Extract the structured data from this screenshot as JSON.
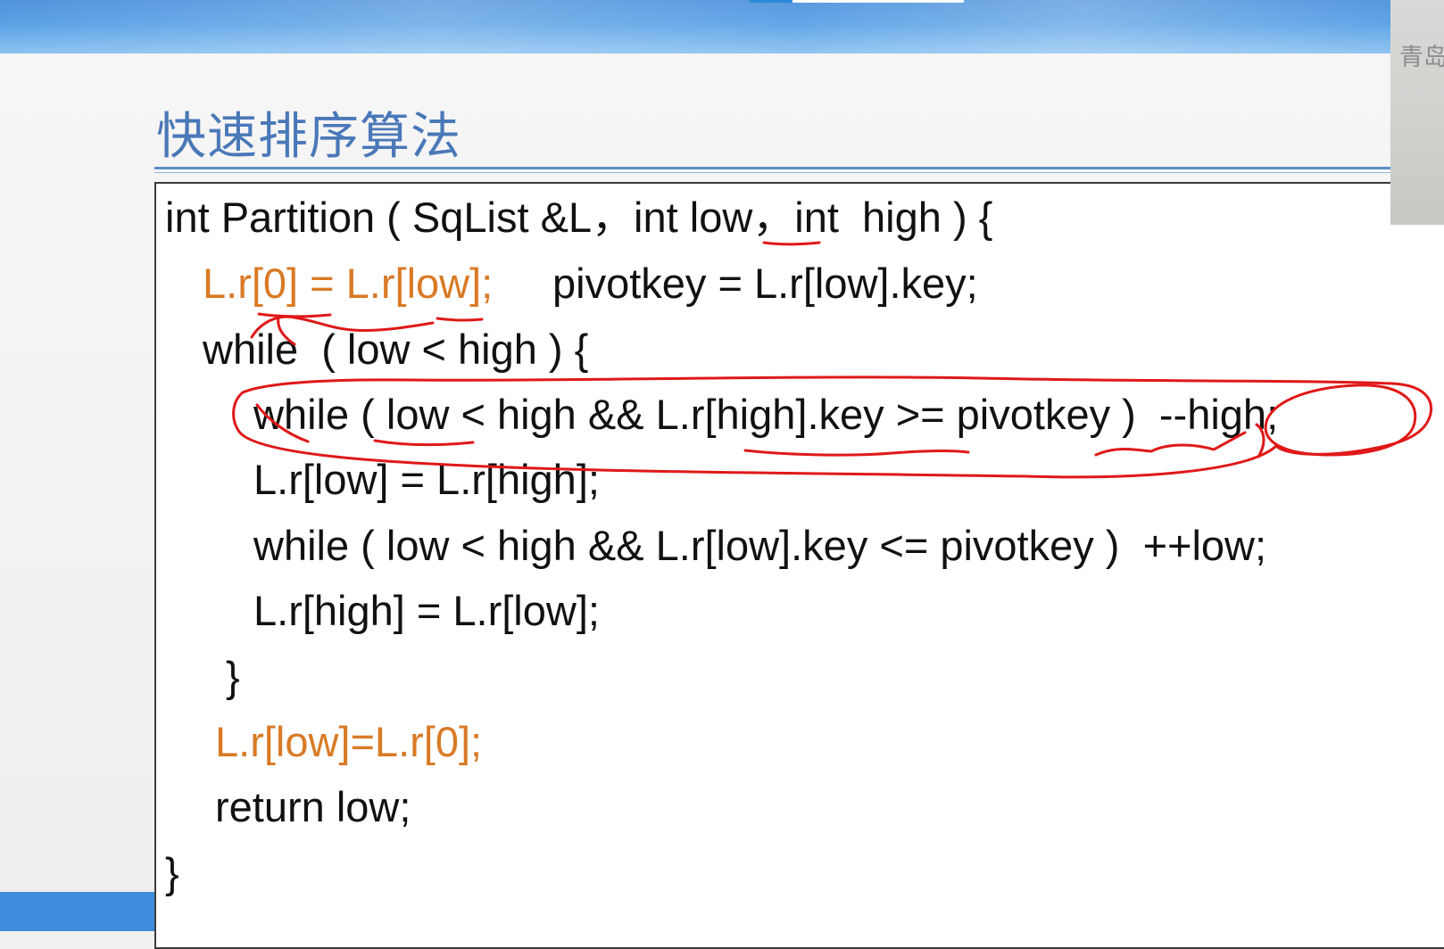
{
  "slide": {
    "title": "快速排序算法",
    "accent_color": "#4a78b8",
    "highlight_color": "#d97a25",
    "annotation_color": "#e01818"
  },
  "code": {
    "lines": [
      "int Partition ( SqList &L，int low，int  high ) {",
      "L.r[0] = L.r[low];",
      "pivotkey = L.r[low].key;",
      "while  ( low < high ) {",
      "while ( low < high && L.r[high].key >= pivotkey )  --high;",
      "L.r[low] = L.r[high];",
      "while ( low < high && L.r[low].key <= pivotkey )  ++low;",
      "L.r[high] = L.r[low];",
      "}",
      "L.r[low]=L.r[0];",
      "return low;",
      "}"
    ]
  },
  "webcam": {
    "text": "青岛"
  }
}
